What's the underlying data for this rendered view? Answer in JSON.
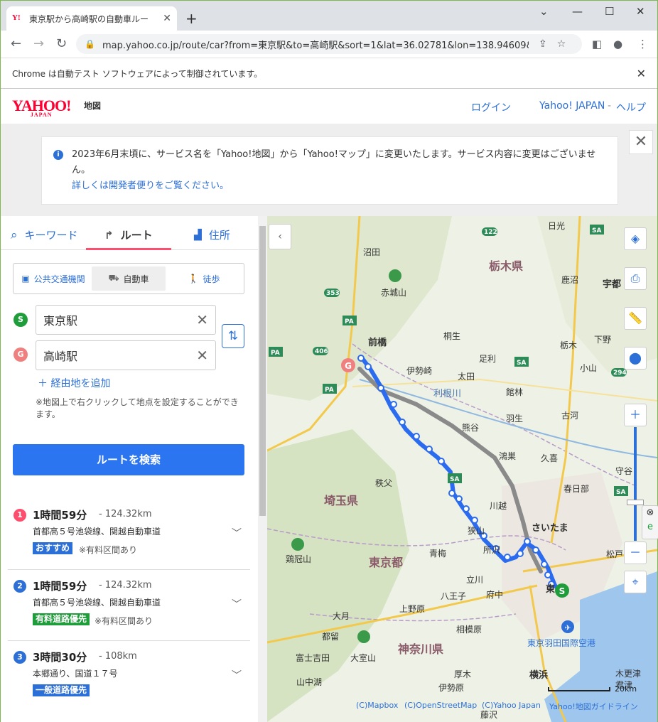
{
  "browser": {
    "tab_title": "東京駅から高崎駅の自動車ルート -",
    "url": "map.yahoo.co.jp/route/car?from=東京駅&to=高崎駅&sort=1&lat=36.02781&lon=138.94609&z...",
    "automation_notice": "Chrome は自動テスト ソフトウェアによって制御されています。"
  },
  "header": {
    "logo": "YAHOO!",
    "logo_sub": "JAPAN",
    "service": "地図",
    "login": "ログイン",
    "yahoo_japan": "Yahoo! JAPAN",
    "separator": "-",
    "help": "ヘルプ"
  },
  "notice": {
    "text": "2023年6月末頃に、サービス名を「Yahoo!地図」から「Yahoo!マップ」に変更いたします。サービス内容に変更はございません。",
    "link": "詳しくは開発者便りをご覧ください。"
  },
  "panel": {
    "tabs": [
      {
        "label": "キーワード"
      },
      {
        "label": "ルート"
      },
      {
        "label": "住所"
      }
    ],
    "modes": [
      {
        "label": "公共交通機関"
      },
      {
        "label": "自動車"
      },
      {
        "label": "徒歩"
      }
    ],
    "from": {
      "marker": "S",
      "value": "東京駅"
    },
    "to": {
      "marker": "G",
      "value": "高崎駅"
    },
    "add_via": "経由地を追加",
    "hint": "※地図上で右クリックして地点を設定することができます。",
    "search_button": "ルートを検索",
    "routes": [
      {
        "num": "1",
        "time": "1時間59分",
        "dist": "124.32km",
        "via": "首都高５号池袋線、関越自動車道",
        "tag": "おすすめ",
        "tag_color": "#2c6fd6",
        "note": "※有料区間あり",
        "num_color": "#ff4d6d"
      },
      {
        "num": "2",
        "time": "1時間59分",
        "dist": "124.32km",
        "via": "首都高５号池袋線、関越自動車道",
        "tag": "有料道路優先",
        "tag_color": "#1f9d3a",
        "note": "※有料区間あり",
        "num_color": "#2c6fd6"
      },
      {
        "num": "3",
        "time": "3時間30分",
        "dist": "108km",
        "via": "本郷通り、国道１７号",
        "tag": "一般道路優先",
        "tag_color": "#2c6fd6",
        "note": "",
        "num_color": "#2c6fd6"
      }
    ],
    "dash": "-"
  },
  "map": {
    "places": [
      {
        "name": "日光"
      },
      {
        "name": "沼田"
      },
      {
        "name": "栃木県"
      },
      {
        "name": "鹿沼"
      },
      {
        "name": "宇都"
      },
      {
        "name": "赤城山"
      },
      {
        "name": "前橋"
      },
      {
        "name": "桐生"
      },
      {
        "name": "栃木"
      },
      {
        "name": "下野"
      },
      {
        "name": "伊勢崎"
      },
      {
        "name": "太田"
      },
      {
        "name": "足利"
      },
      {
        "name": "小山"
      },
      {
        "name": "利根川"
      },
      {
        "name": "館林"
      },
      {
        "name": "古河"
      },
      {
        "name": "羽生"
      },
      {
        "name": "熊谷"
      },
      {
        "name": "鴻巣"
      },
      {
        "name": "久喜"
      },
      {
        "name": "秩父"
      },
      {
        "name": "埼玉県"
      },
      {
        "name": "春日部"
      },
      {
        "name": "川越"
      },
      {
        "name": "さいたま"
      },
      {
        "name": "狭山"
      },
      {
        "name": "所沢"
      },
      {
        "name": "鶏冠山"
      },
      {
        "name": "東京都"
      },
      {
        "name": "青梅"
      },
      {
        "name": "立川"
      },
      {
        "name": "八王子"
      },
      {
        "name": "府中"
      },
      {
        "name": "大月"
      },
      {
        "name": "上野原"
      },
      {
        "name": "都留"
      },
      {
        "name": "相模原"
      },
      {
        "name": "富士吉田"
      },
      {
        "name": "大室山"
      },
      {
        "name": "神奈川県"
      },
      {
        "name": "山中湖"
      },
      {
        "name": "厚木"
      },
      {
        "name": "横浜"
      },
      {
        "name": "伊勢原"
      },
      {
        "name": "東京羽田国際空港"
      },
      {
        "name": "松戸"
      },
      {
        "name": "守谷"
      },
      {
        "name": "君津"
      },
      {
        "name": "木更津"
      },
      {
        "name": "東"
      },
      {
        "name": "藤沢"
      }
    ],
    "route_labels": [
      "SA",
      "SA",
      "PA",
      "PA",
      "PA",
      "SA",
      "SA"
    ],
    "road_numbers": [
      "122",
      "353",
      "406",
      "294"
    ],
    "scale": "20km",
    "credits": [
      "(C)Mapbox",
      "(C)OpenStreetMap",
      "(C)Yahoo Japan",
      "Yahoo!地図ガイドライン"
    ]
  }
}
